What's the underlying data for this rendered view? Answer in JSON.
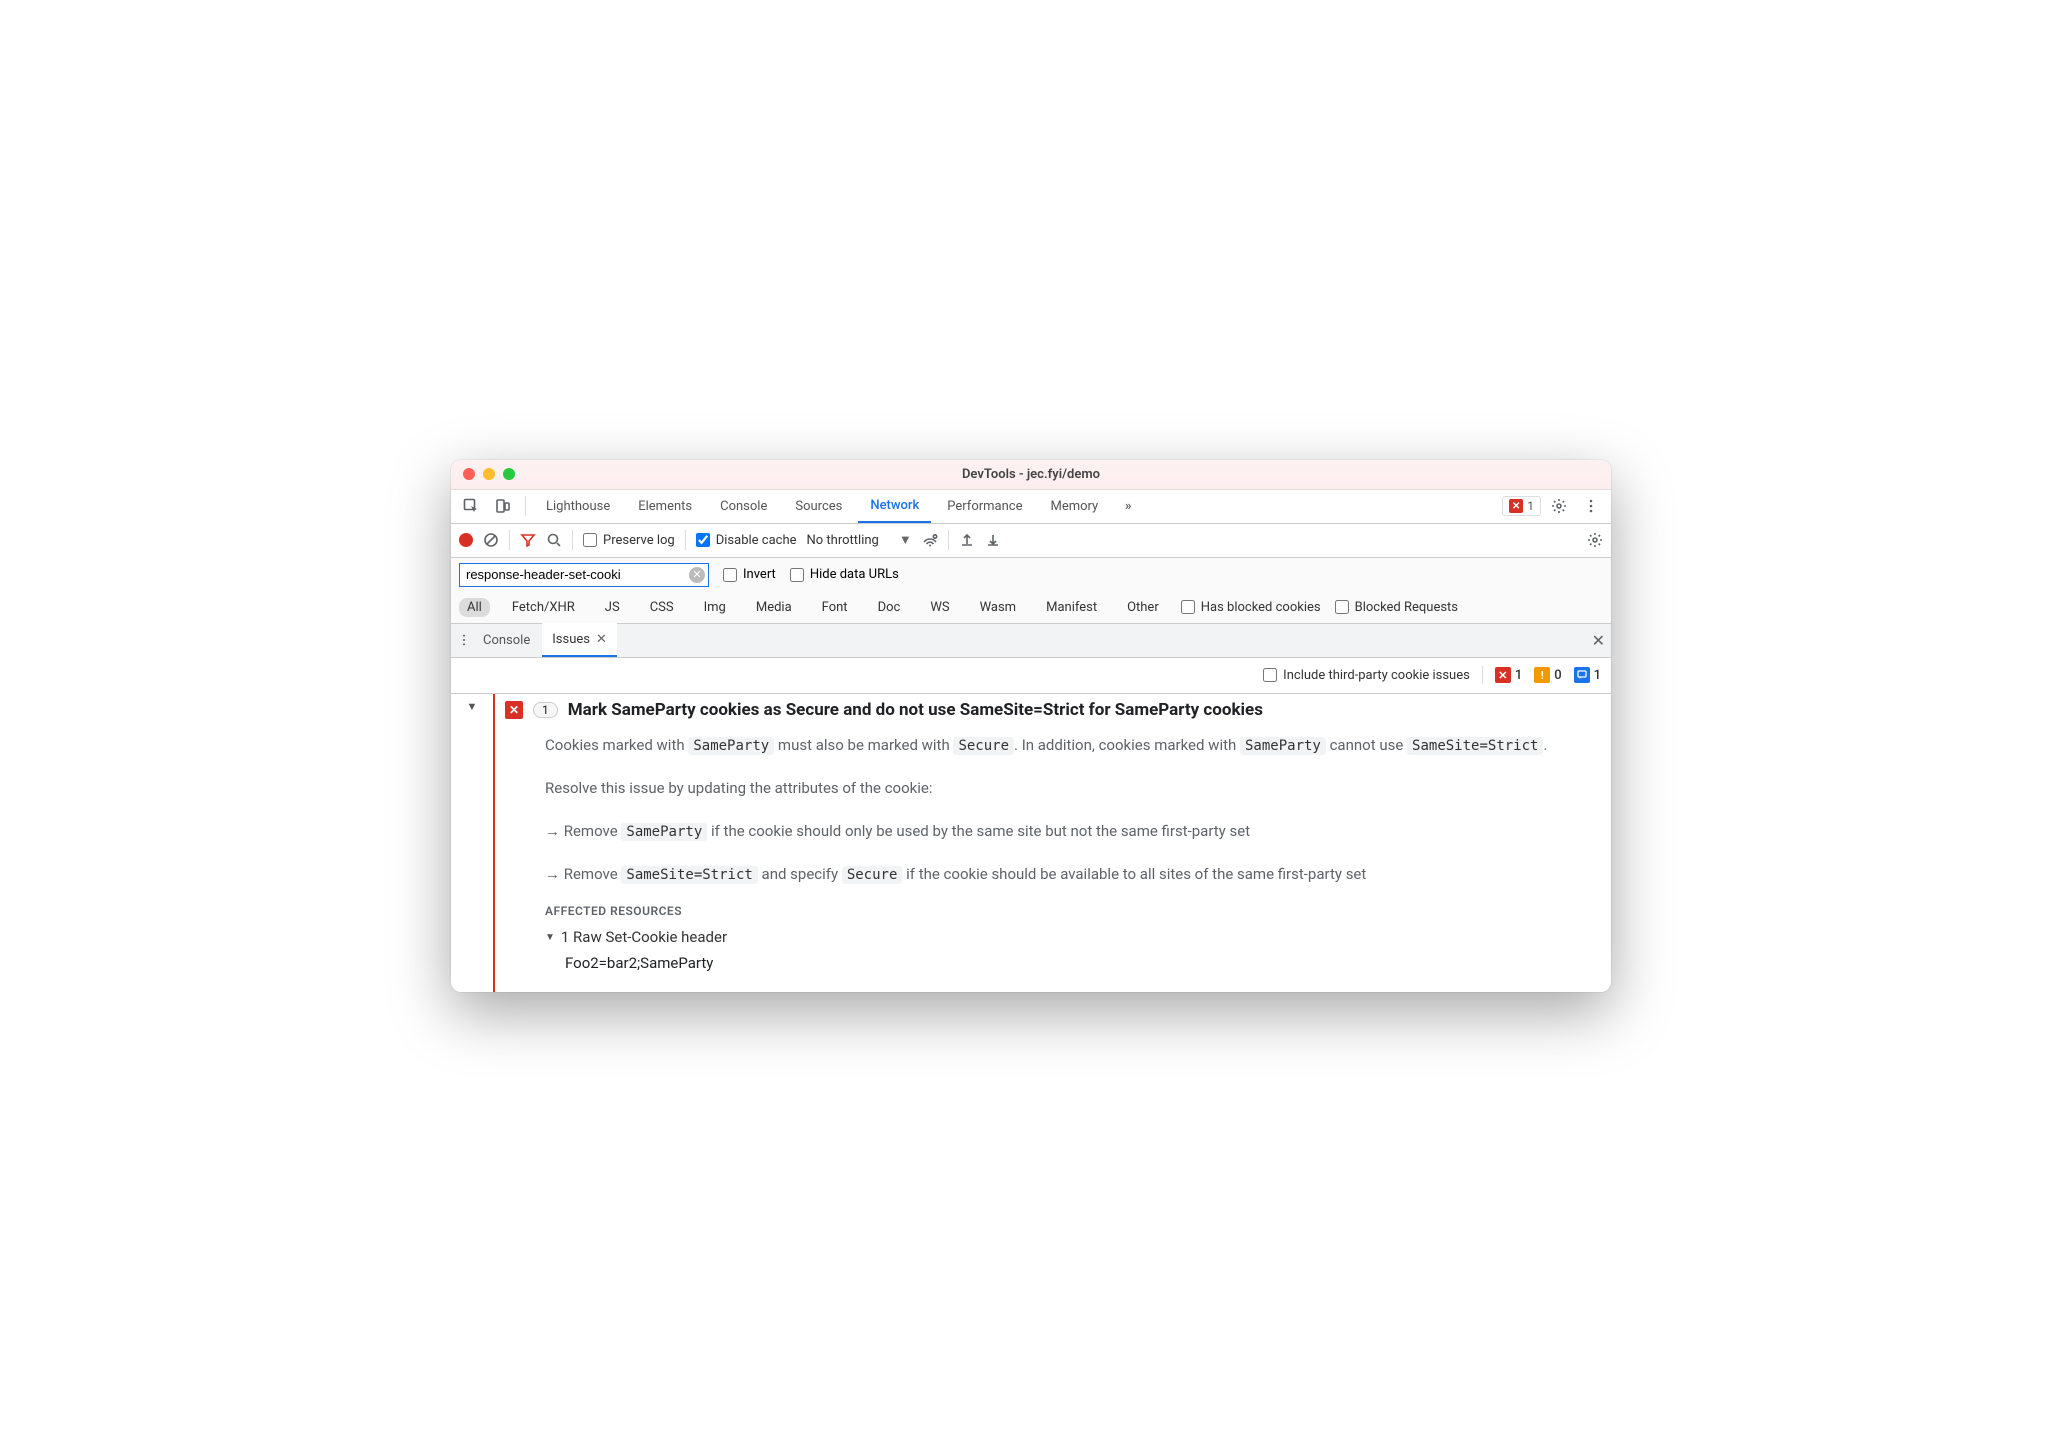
{
  "window": {
    "title": "DevTools - jec.fyi/demo"
  },
  "mainTabs": {
    "items": [
      "Lighthouse",
      "Elements",
      "Console",
      "Sources",
      "Network",
      "Performance",
      "Memory"
    ],
    "active": "Network",
    "overflowIcon": ">>",
    "errorBadgeCount": "1"
  },
  "netToolbar": {
    "preserveLog": "Preserve log",
    "preserveLogChecked": false,
    "disableCache": "Disable cache",
    "disableCacheChecked": true,
    "throttling": "No throttling"
  },
  "filter": {
    "value": "response-header-set-cooki",
    "invert": "Invert",
    "hideDataUrls": "Hide data URLs"
  },
  "types": {
    "items": [
      "All",
      "Fetch/XHR",
      "JS",
      "CSS",
      "Img",
      "Media",
      "Font",
      "Doc",
      "WS",
      "Wasm",
      "Manifest",
      "Other"
    ],
    "active": "All",
    "hasBlocked": "Has blocked cookies",
    "blockedReq": "Blocked Requests"
  },
  "drawer": {
    "tabs": [
      "Console",
      "Issues"
    ],
    "active": "Issues"
  },
  "issuesHeader": {
    "includeThirdParty": "Include third-party cookie issues",
    "counts": {
      "error": "1",
      "warn": "0",
      "info": "1"
    }
  },
  "issue": {
    "count": "1",
    "title": "Mark SameParty cookies as Secure and do not use SameSite=Strict for SameParty cookies",
    "p1_a": "Cookies marked with ",
    "p1_code1": "SameParty",
    "p1_b": " must also be marked with ",
    "p1_code2": "Secure",
    "p1_c": ". In addition, cookies marked with ",
    "p1_code3": "SameParty",
    "p1_d": " cannot use ",
    "p1_code4": "SameSite=Strict",
    "p1_e": ".",
    "p2": "Resolve this issue by updating the attributes of the cookie:",
    "b1_a": "Remove ",
    "b1_code": "SameParty",
    "b1_b": " if the cookie should only be used by the same site but not the same first-party set",
    "b2_a": "Remove ",
    "b2_code1": "SameSite=Strict",
    "b2_b": " and specify ",
    "b2_code2": "Secure",
    "b2_c": " if the cookie should be available to all sites of the same first-party set",
    "affectedHeading": "AFFECTED RESOURCES",
    "affectedRow": "1 Raw Set-Cookie header",
    "cookieValue": "Foo2=bar2;SameParty"
  }
}
